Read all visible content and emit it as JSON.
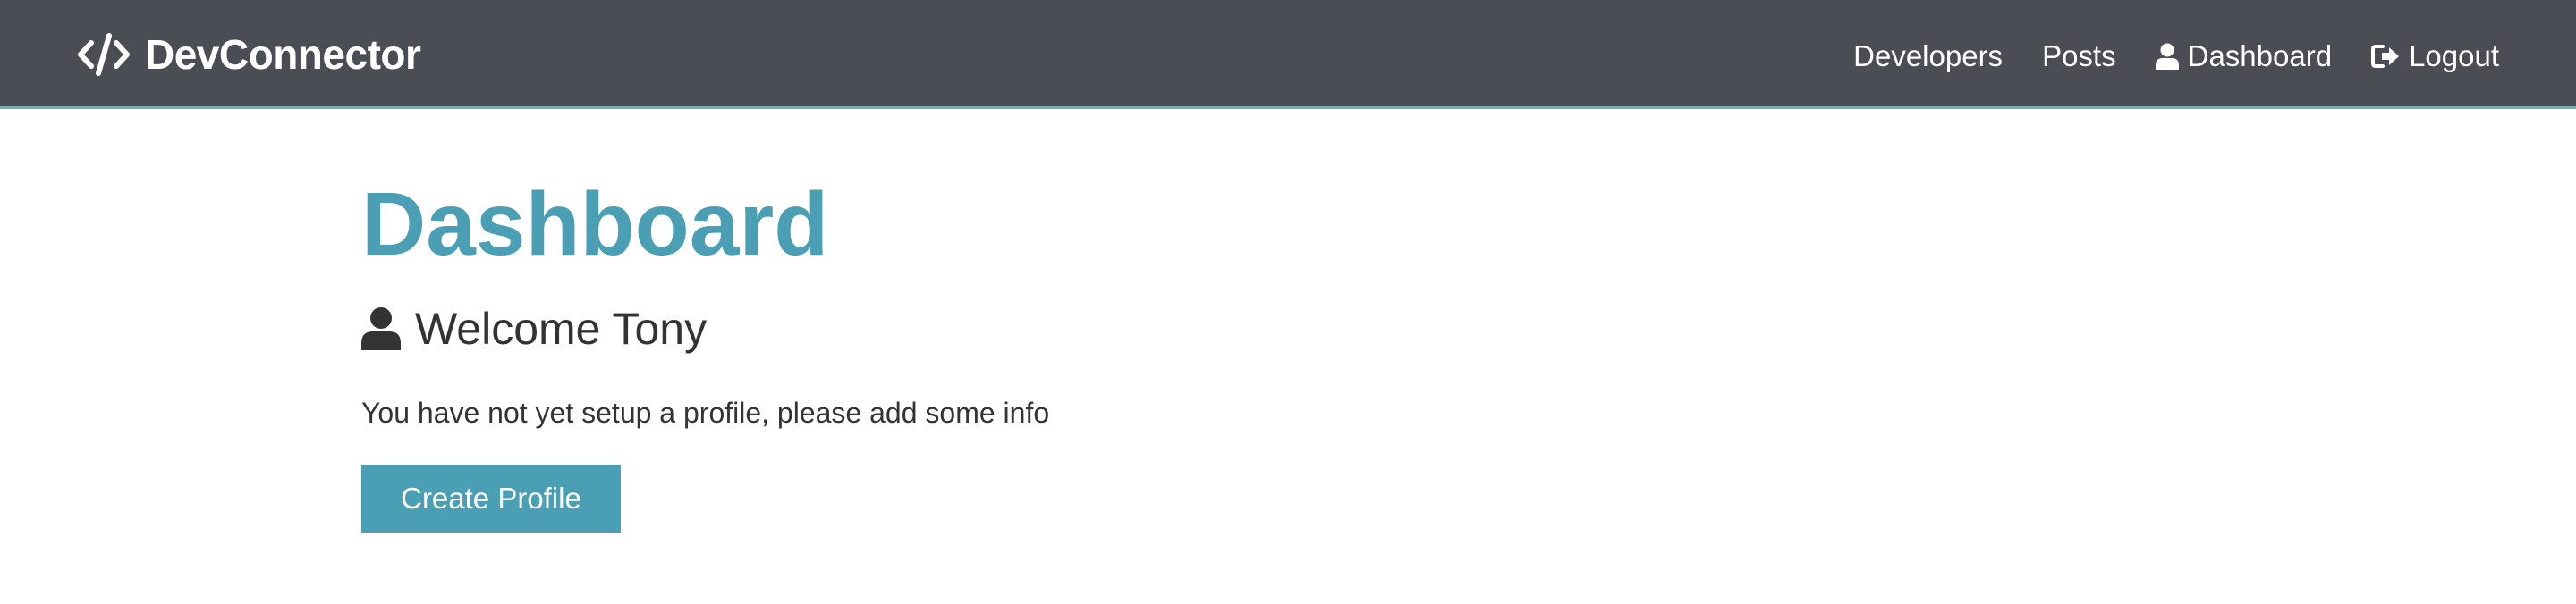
{
  "navbar": {
    "brand": {
      "icon": "code-icon",
      "label": "DevConnector"
    },
    "links": [
      {
        "label": "Developers",
        "icon": ""
      },
      {
        "label": "Posts",
        "icon": ""
      },
      {
        "label": "Dashboard",
        "icon": "user-icon"
      },
      {
        "label": "Logout",
        "icon": "sign-out-icon"
      }
    ]
  },
  "main": {
    "title": "Dashboard",
    "welcome": {
      "icon": "user-icon",
      "text": "Welcome Tony"
    },
    "info": "You have not yet setup a profile, please add some info",
    "create_profile_label": "Create Profile"
  },
  "colors": {
    "navbar_bg": "#4a4e54",
    "navbar_border": "#5fb3c4",
    "accent": "#4a9fb5",
    "text": "#333333"
  }
}
